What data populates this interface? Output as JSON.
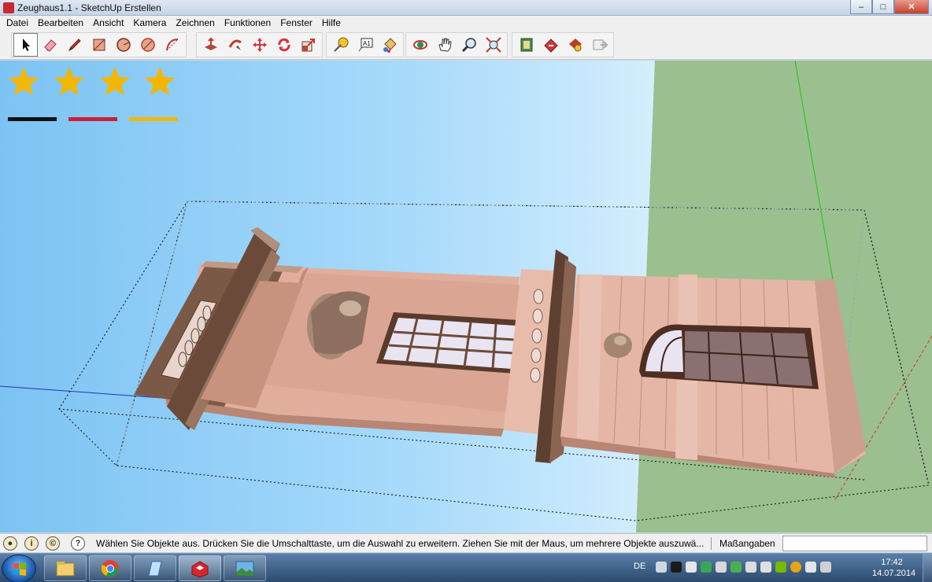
{
  "window": {
    "title": "Zeughaus1.1 - SketchUp Erstellen",
    "controls": {
      "minimize": "–",
      "maximize": "□",
      "close": "✕"
    }
  },
  "menu": [
    "Datei",
    "Bearbeiten",
    "Ansicht",
    "Kamera",
    "Zeichnen",
    "Funktionen",
    "Fenster",
    "Hilfe"
  ],
  "toolbar": {
    "active_tool": "select",
    "tools": [
      "select-arrow-icon",
      "eraser-icon",
      "pencil-icon",
      "rectangle-icon",
      "circle-icon",
      "polygon-icon",
      "arc-icon",
      "push-pull-icon",
      "follow-me-icon",
      "move-icon",
      "rotate-icon",
      "scale-icon",
      "tape-measure-icon",
      "text-icon",
      "paint-bucket-icon",
      "orbit-icon",
      "pan-icon",
      "zoom-icon",
      "zoom-extents-icon",
      "get-models-icon",
      "share-model-icon",
      "extension-warehouse-icon",
      "send-to-layout-icon"
    ],
    "text_tool_label": "A1"
  },
  "badge": {
    "star_color": "#f2b705",
    "stripes": [
      "#111111",
      "#cc1f35",
      "#f2b705"
    ]
  },
  "colors": {
    "sky_left": "#7cc3f3",
    "sky_right": "#d3eefc",
    "ground": "#9bbf8e",
    "stone": "#e2ae9c",
    "stone_dark": "#7a5a47",
    "window_glass": "#e9e4f1"
  },
  "statusbar": {
    "text": "Wählen Sie Objekte aus. Drücken Sie die Umschalttaste, um die Auswahl zu erweitern. Ziehen Sie mit der Maus, um mehrere Objekte auszuwä...",
    "measurement_label": "Maßangaben",
    "measurement_value": "",
    "help_glyph": "?"
  },
  "taskbar": {
    "apps": [
      "windows-explorer-icon",
      "chrome-icon",
      "notepad-icon",
      "sketchup-icon",
      "image-viewer-icon"
    ],
    "language": "DE",
    "time": "17:42",
    "date": "14.07.2014"
  }
}
